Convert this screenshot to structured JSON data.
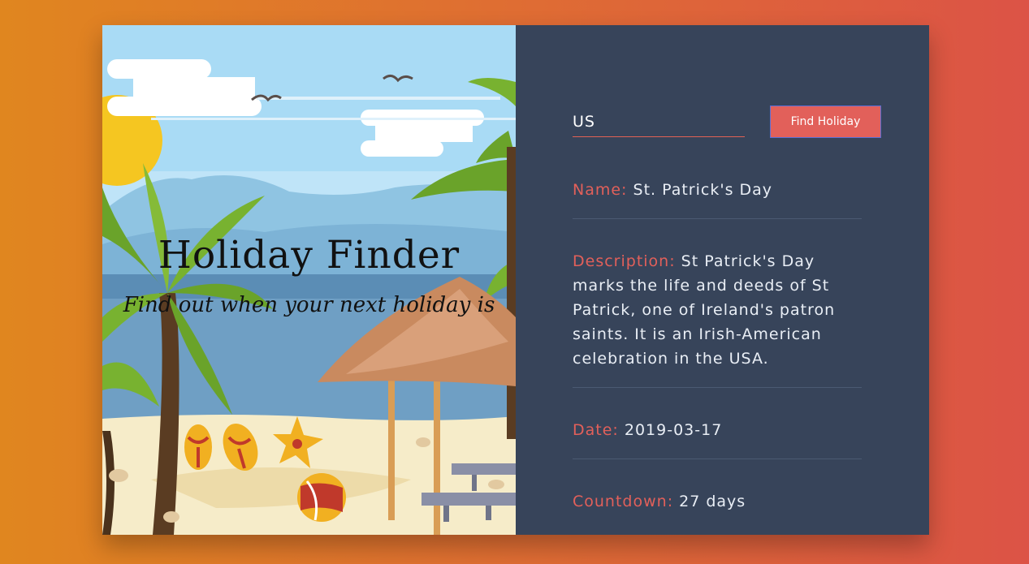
{
  "hero": {
    "title": "Holiday Finder",
    "subtitle": "Find out when your next holiday is"
  },
  "search": {
    "value": "US",
    "button_label": "Find Holiday"
  },
  "result": {
    "name_label": "Name:",
    "name_value": "St. Patrick's Day",
    "description_label": "Description:",
    "description_value": "St Patrick's Day marks the life and deeds of St Patrick, one of Ireland's patron saints. It is an Irish-American celebration in the USA.",
    "date_label": "Date:",
    "date_value": "2019-03-17",
    "countdown_label": "Countdown:",
    "countdown_value": "27 days"
  },
  "colors": {
    "panel": "#37445a",
    "accent": "#e2605a",
    "text": "#e9eef5"
  }
}
